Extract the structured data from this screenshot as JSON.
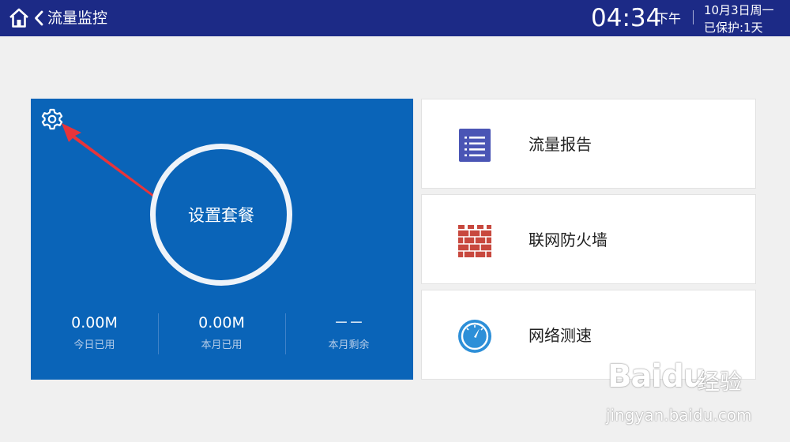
{
  "header": {
    "title": "流量监控",
    "clock": "04:34",
    "ampm": "下午",
    "date": "10月3日周一",
    "protection": "已保护:1天"
  },
  "panel": {
    "center_button": "设置套餐",
    "stats": [
      {
        "value": "0.00M",
        "label": "今日已用"
      },
      {
        "value": "0.00M",
        "label": "本月已用"
      },
      {
        "value": "－－",
        "label": "本月剩余"
      }
    ]
  },
  "menu": [
    {
      "label": "流量报告",
      "icon": "report-list-icon"
    },
    {
      "label": "联网防火墙",
      "icon": "firewall-brick-icon"
    },
    {
      "label": "网络测速",
      "icon": "speedometer-icon"
    }
  ],
  "colors": {
    "header_bg": "#1c2a86",
    "panel_bg": "#0a64b8",
    "page_bg": "#f0f0f0",
    "annotation_arrow": "#e8343a"
  },
  "watermark": {
    "brand": "Baidu",
    "word": "经验",
    "url": "jingyan.baidu.com"
  }
}
